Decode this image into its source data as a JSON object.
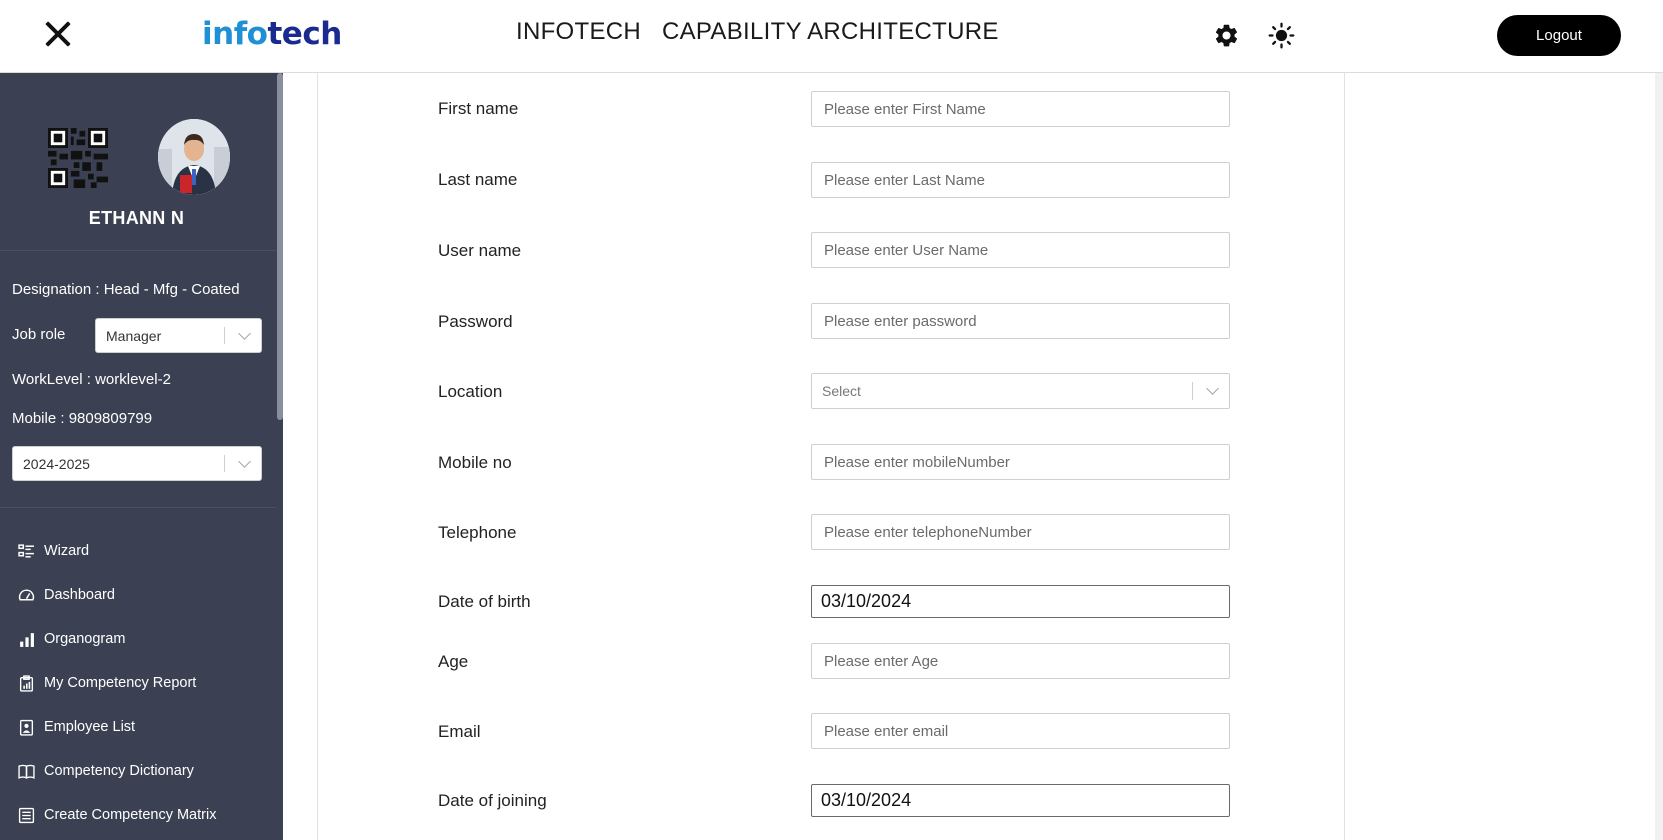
{
  "header": {
    "logo_part1": "info",
    "logo_part2": "tech",
    "title": "INFOTECH   CAPABILITY ARCHITECTURE",
    "logout_label": "Logout"
  },
  "sidebar": {
    "user_name": "ETHANN N",
    "designation": "Designation : Head - Mfg - Coated",
    "job_role_label": "Job role",
    "job_role_value": "Manager",
    "worklevel": "WorkLevel :  worklevel-2",
    "mobile": "Mobile :   9809809799",
    "year_value": "2024-2025",
    "nav": [
      {
        "label": "Wizard",
        "icon": "wizard-icon"
      },
      {
        "label": "Dashboard",
        "icon": "dashboard-icon"
      },
      {
        "label": "Organogram",
        "icon": "bar-chart-icon"
      },
      {
        "label": "My Competency Report",
        "icon": "report-icon"
      },
      {
        "label": "Employee List",
        "icon": "employee-icon"
      },
      {
        "label": "Competency Dictionary",
        "icon": "book-icon"
      },
      {
        "label": "Create Competency Matrix",
        "icon": "matrix-icon"
      }
    ]
  },
  "form": {
    "first_name": {
      "label": "First name",
      "placeholder": "Please enter First Name"
    },
    "last_name": {
      "label": "Last name",
      "placeholder": "Please enter Last Name"
    },
    "user_name": {
      "label": "User name",
      "placeholder": "Please enter User Name"
    },
    "password": {
      "label": "Password",
      "placeholder": "Please enter password"
    },
    "location": {
      "label": "Location",
      "placeholder": "Select"
    },
    "mobile_no": {
      "label": "Mobile no",
      "placeholder": "Please enter mobileNumber"
    },
    "telephone": {
      "label": "Telephone",
      "placeholder": "Please enter telephoneNumber"
    },
    "dob": {
      "label": "Date of birth",
      "value": "03/10/2024"
    },
    "age": {
      "label": "Age",
      "placeholder": "Please enter Age"
    },
    "email": {
      "label": "Email",
      "placeholder": "Please enter email"
    },
    "doj": {
      "label": "Date of joining",
      "value": "03/10/2024"
    }
  },
  "colors": {
    "sidebar_bg": "#3b4152",
    "logo_blue": "#1f8fd6",
    "logo_navy": "#1b2a8f",
    "logout_bg": "#000000"
  }
}
